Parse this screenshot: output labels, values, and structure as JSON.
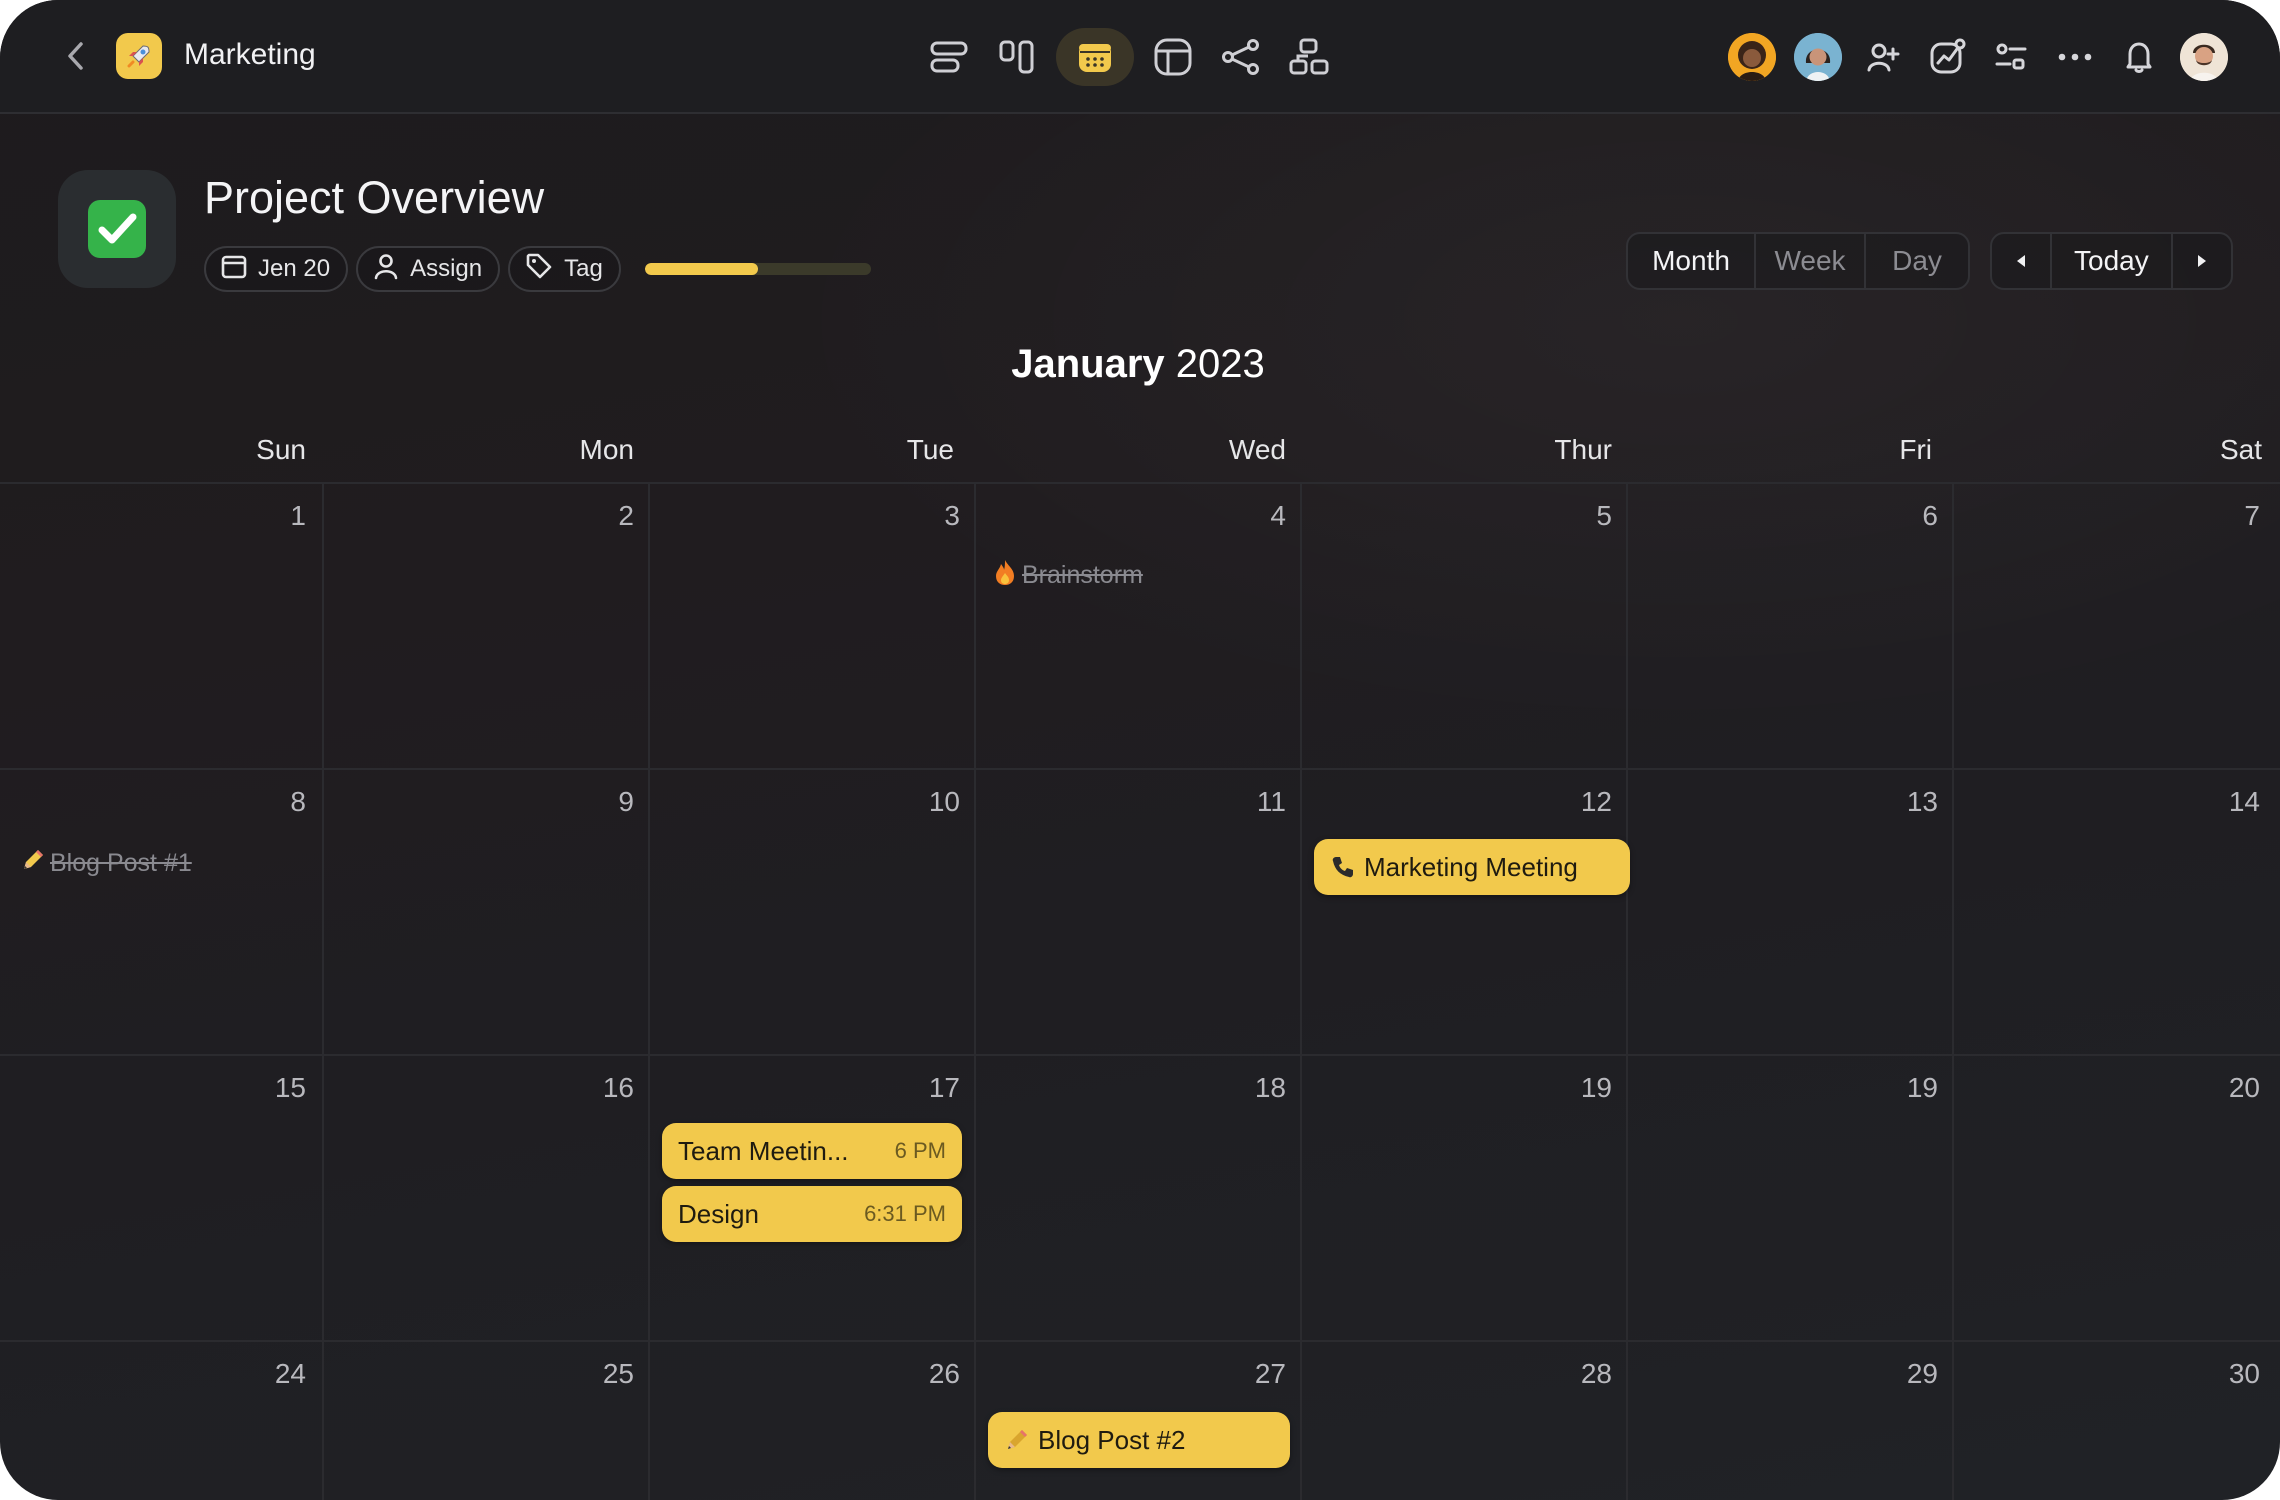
{
  "app": {
    "workspace": "Marketing",
    "icons": {
      "back": "chevron-left-icon",
      "logo": "rocket-icon",
      "views": [
        "list-view-icon",
        "board-view-icon",
        "calendar-view-icon",
        "table-view-icon",
        "workflow-view-icon",
        "map-view-icon"
      ],
      "tools": [
        "add-member-icon",
        "analytics-icon",
        "filter-icon",
        "more-icon",
        "bell-icon"
      ]
    },
    "colors": {
      "accent": "#f2c94c",
      "background": "#1f1e22",
      "success": "#35b34a"
    }
  },
  "project": {
    "title": "Project Overview",
    "chips": {
      "date": "Jen 20",
      "assign": "Assign",
      "tag": "Tag"
    },
    "progress": 0.5
  },
  "view_modes": {
    "month": "Month",
    "week": "Week",
    "day": "Day",
    "selected": "Month"
  },
  "navigation": {
    "today": "Today"
  },
  "calendar": {
    "month": "January",
    "year": "2023",
    "weekdays": [
      "Sun",
      "Mon",
      "Tue",
      "Wed",
      "Thur",
      "Fri",
      "Sat"
    ],
    "weeks": [
      [
        "1",
        "2",
        "3",
        "4",
        "5",
        "6",
        "7"
      ],
      [
        "8",
        "9",
        "10",
        "11",
        "12",
        "13",
        "14"
      ],
      [
        "15",
        "16",
        "17",
        "18",
        "19",
        "19",
        "20"
      ],
      [
        "24",
        "25",
        "26",
        "27",
        "28",
        "29",
        "30"
      ]
    ],
    "events": {
      "brainstorm": {
        "title": "Brainstorm",
        "emoji": "fire-icon",
        "done": true
      },
      "blog1": {
        "title": "Blog Post #1",
        "emoji": "pencil-icon",
        "done": true
      },
      "marketing_meeting": {
        "title": "Marketing Meeting",
        "emoji": "phone-icon"
      },
      "team_meeting": {
        "title": "Team Meetin...",
        "time": "6 PM"
      },
      "design": {
        "title": "Design",
        "time": "6:31 PM"
      },
      "blog2": {
        "title": "Blog Post #2",
        "emoji": "pencil-icon"
      }
    }
  }
}
